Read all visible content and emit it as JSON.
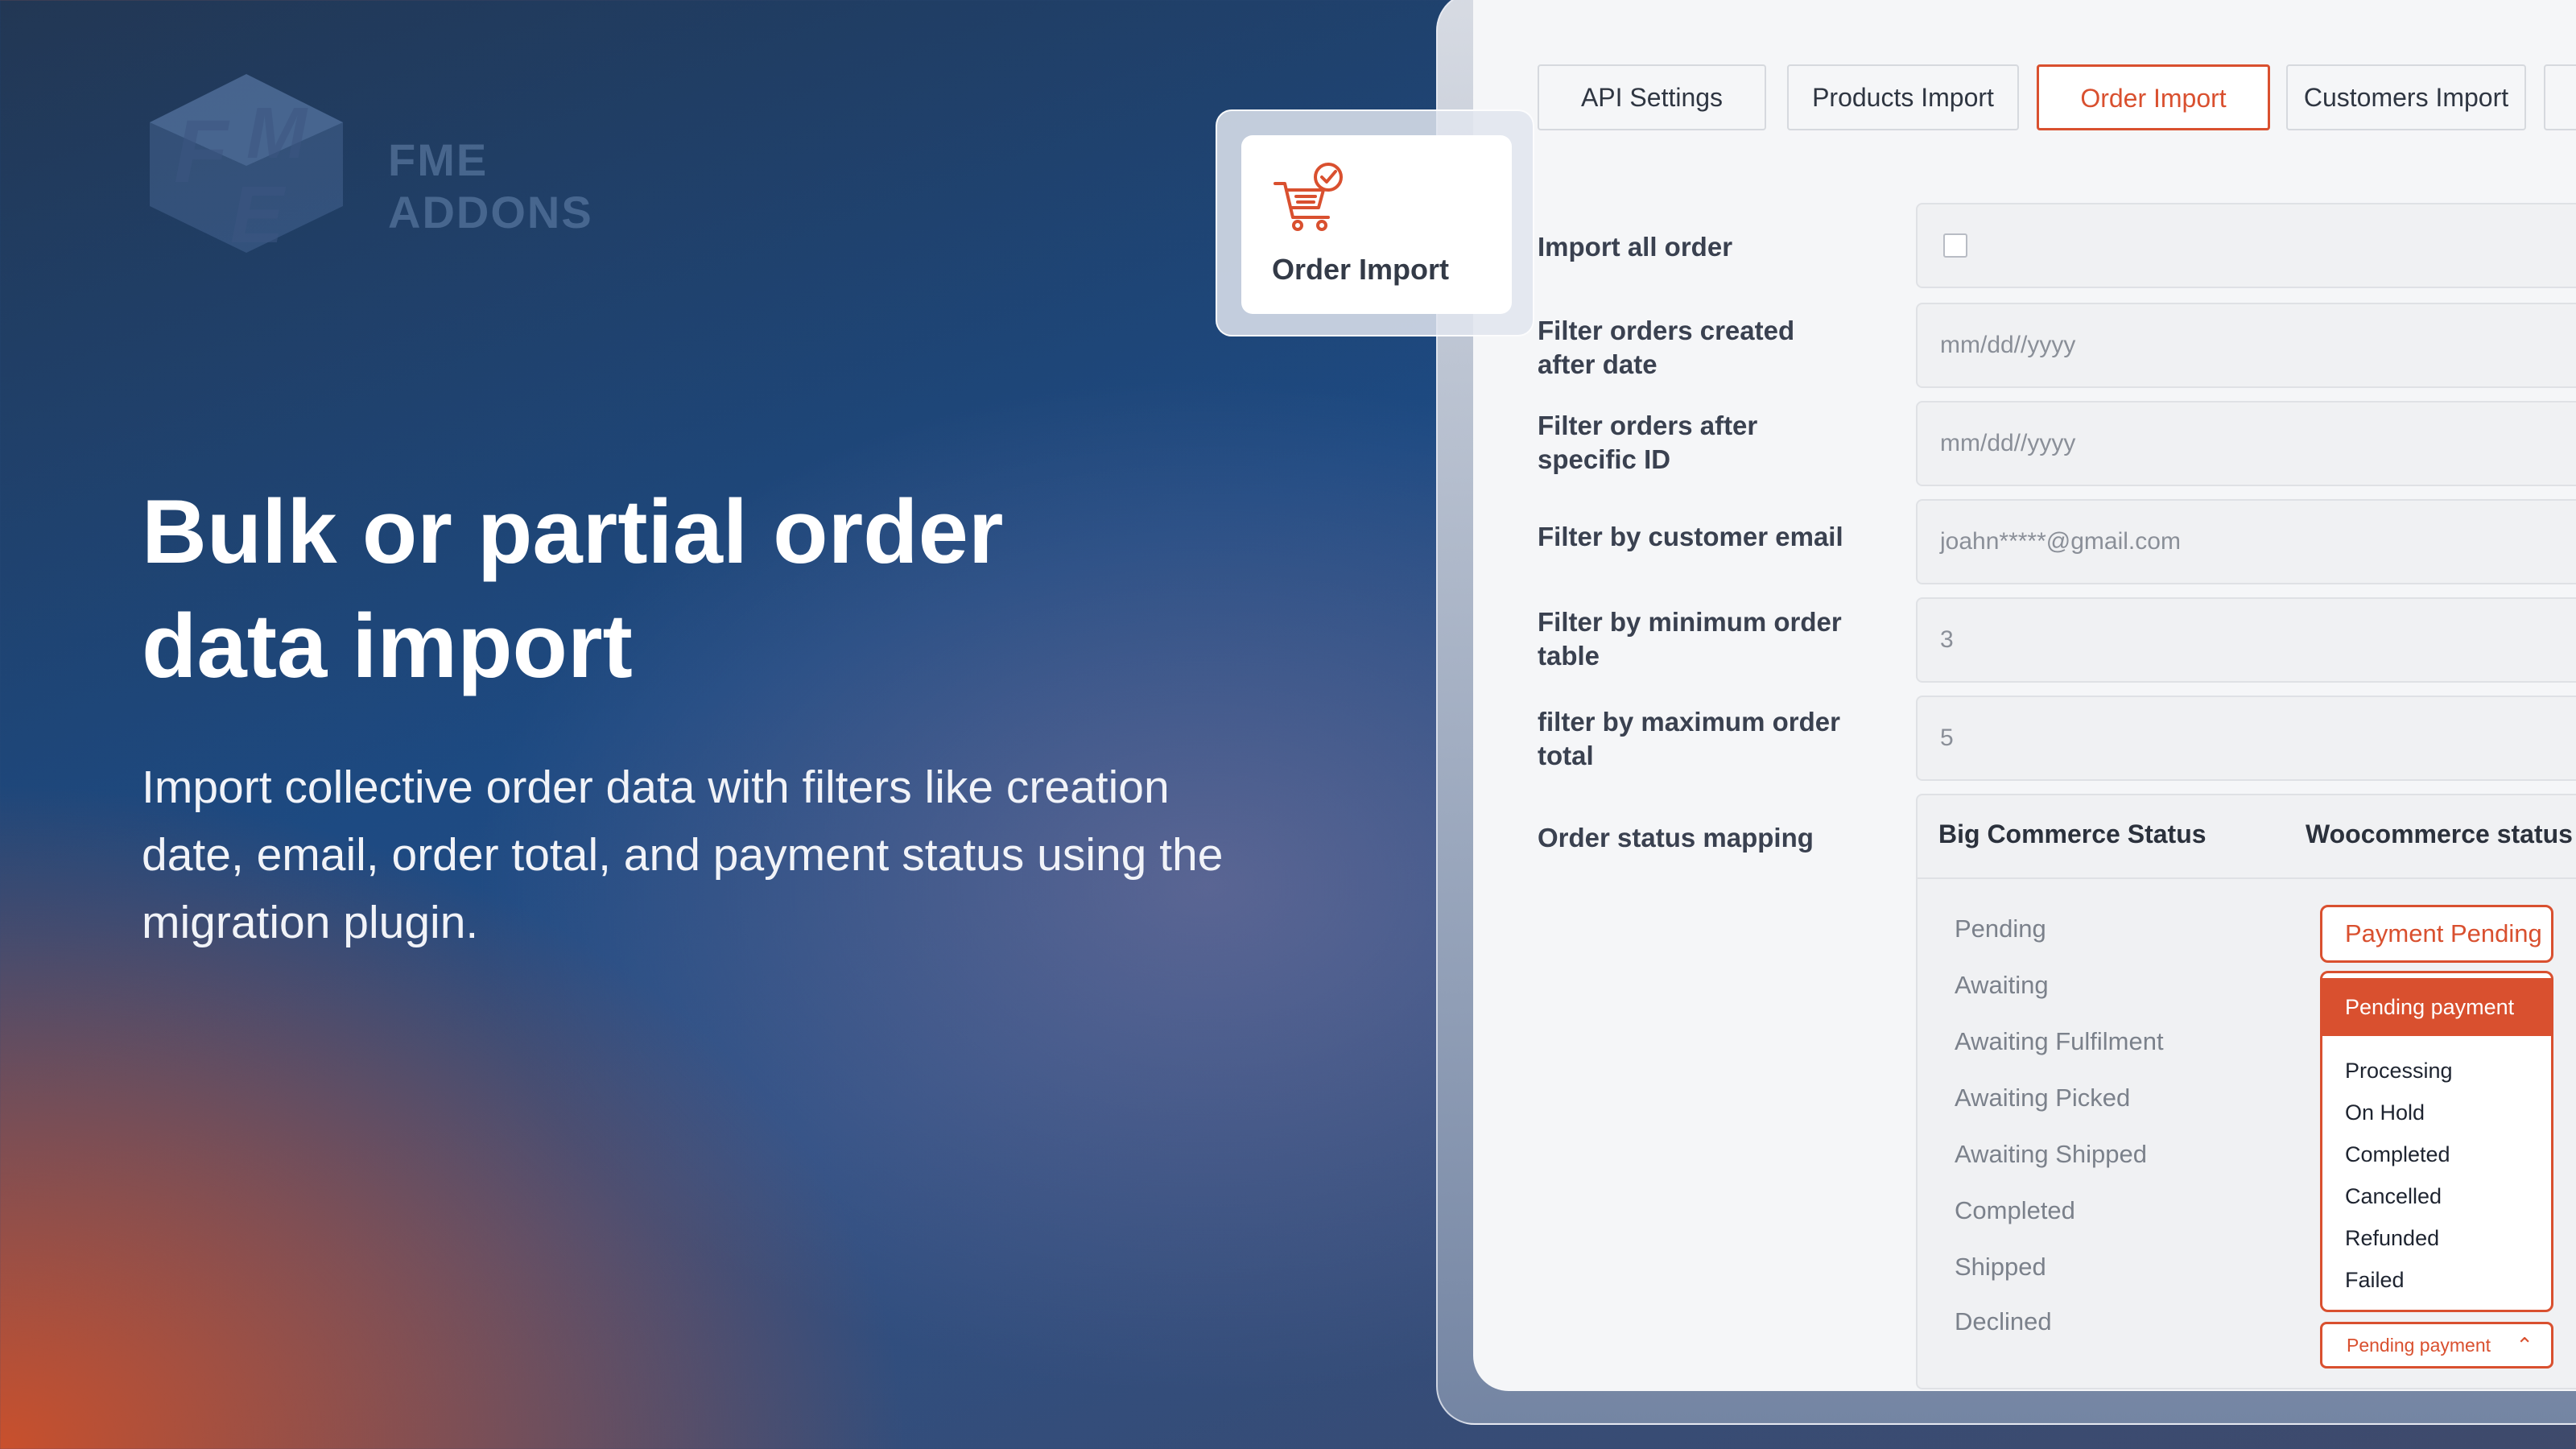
{
  "brand": {
    "name": "FME ADDONS",
    "logo_icon": "fme-cube-logo"
  },
  "hero": {
    "title_line1": "Bulk or partial order",
    "title_line2": "data import",
    "subtitle_line1": "Import collective order data with filters like creation",
    "subtitle_line2": "date, email, order total, and payment status using the",
    "subtitle_line3": "migration plugin."
  },
  "tabs": [
    {
      "label": "API Settings",
      "active": false
    },
    {
      "label": "Products Import",
      "active": false
    },
    {
      "label": "Order Import",
      "active": true
    },
    {
      "label": "Customers Import",
      "active": false
    }
  ],
  "floating_card": {
    "label": "Order Import",
    "icon": "cart-check-icon"
  },
  "form": {
    "import_all": {
      "label": "Import all order",
      "checked": false
    },
    "created_after": {
      "label_line1": "Filter orders created",
      "label_line2": "after date",
      "placeholder": "mm/dd//yyyy"
    },
    "after_id": {
      "label_line1": "Filter orders after",
      "label_line2": "specific ID",
      "placeholder": "mm/dd//yyyy"
    },
    "customer_email": {
      "label": "Filter by customer email",
      "placeholder": "joahn*****@gmail.com"
    },
    "min_order": {
      "label_line1": "Filter by minimum order",
      "label_line2": "table",
      "value": "3"
    },
    "max_order": {
      "label_line1": "filter by maximum order",
      "label_line2": "total",
      "value": "5"
    },
    "status_mapping_label": "Order status mapping"
  },
  "mapping": {
    "col_left": "Big Commerce Status",
    "col_right": "Woocommerce status",
    "bigcommerce_statuses": [
      "Pending",
      "Awaiting",
      "Awaiting Fulfilment",
      "Awaiting Picked",
      "Awaiting Shipped",
      "Completed",
      "Shipped",
      "Declined"
    ],
    "top_select_value": "Payment Pending",
    "dropdown_selected": "Pending payment",
    "dropdown_options": [
      "Processing",
      "On Hold",
      "Completed",
      "Cancelled",
      "Refunded",
      "Failed"
    ],
    "bottom_select_value": "Pending payment"
  },
  "colors": {
    "accent": "#d9502f",
    "hero_text": "#ffffff",
    "panel_bg": "#f5f6f8"
  }
}
